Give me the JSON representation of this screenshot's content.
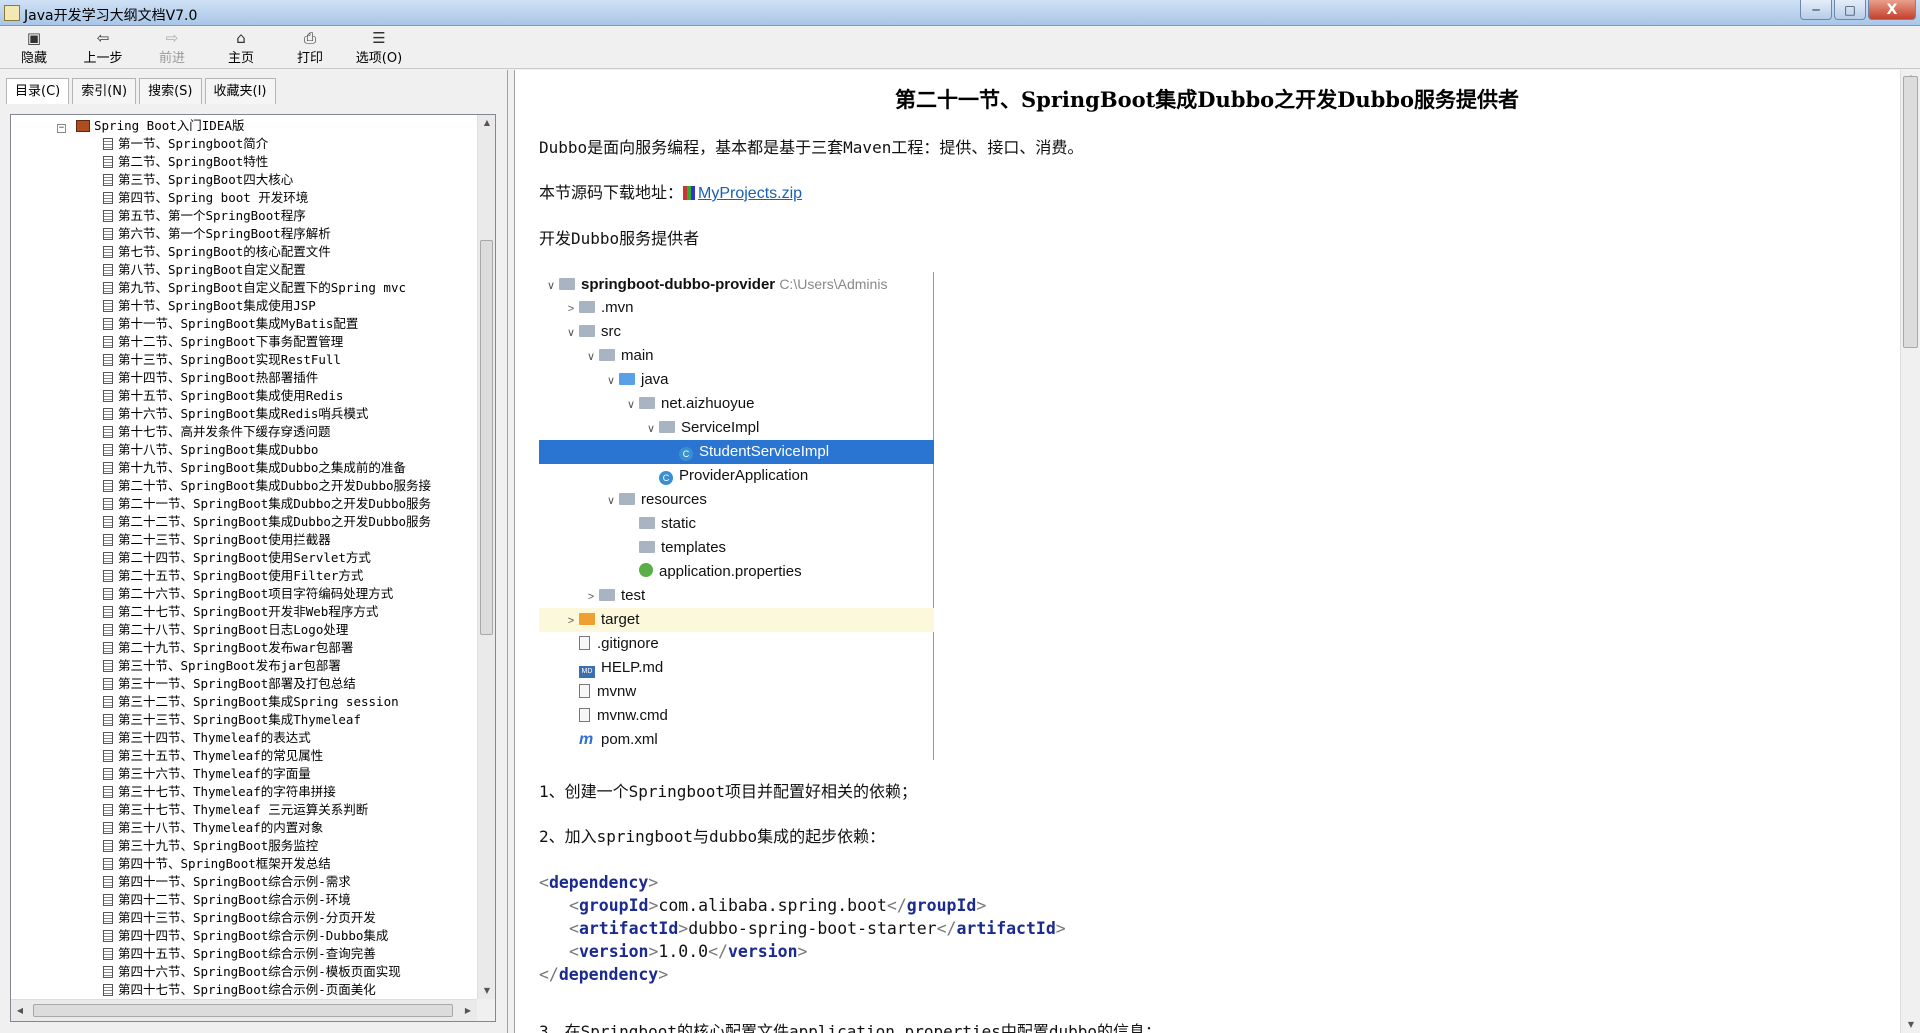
{
  "window": {
    "title": "Java开发学习大纲文档V7.0",
    "min": "─",
    "max": "□",
    "close": "X"
  },
  "toolbar": [
    {
      "label": "隐藏",
      "icon": "hide-icon",
      "glyph": "▣"
    },
    {
      "label": "上一步",
      "icon": "back-arrow-icon",
      "glyph": "⇦"
    },
    {
      "label": "前进",
      "icon": "forward-arrow-icon",
      "glyph": "⇨"
    },
    {
      "label": "主页",
      "icon": "home-icon",
      "glyph": "⌂"
    },
    {
      "label": "打印",
      "icon": "printer-icon",
      "glyph": "⎙"
    },
    {
      "label": "选项(O)",
      "icon": "options-icon",
      "glyph": "☰"
    }
  ],
  "tabs": [
    "目录(C)",
    "索引(N)",
    "搜索(S)",
    "收藏夹(I)"
  ],
  "tree": {
    "root": "Spring Boot入门IDEA版",
    "items": [
      "第一节、Springboot简介",
      "第二节、SpringBoot特性",
      "第三节、SpringBoot四大核心",
      "第四节、Spring boot 开发环境",
      "第五节、第一个SpringBoot程序",
      "第六节、第一个SpringBoot程序解析",
      "第七节、SpringBoot的核心配置文件",
      "第八节、SpringBoot自定义配置",
      "第九节、SpringBoot自定义配置下的Spring mvc",
      "第十节、SpringBoot集成使用JSP",
      "第十一节、SpringBoot集成MyBatis配置",
      "第十二节、SpringBoot下事务配置管理",
      "第十三节、SpringBoot实现RestFull",
      "第十四节、SpringBoot热部署插件",
      "第十五节、SpringBoot集成使用Redis",
      "第十六节、SpringBoot集成Redis哨兵模式",
      "第十七节、高并发条件下缓存穿透问题",
      "第十八节、SpringBoot集成Dubbo",
      "第十九节、SpringBoot集成Dubbo之集成前的准备",
      "第二十节、SpringBoot集成Dubbo之开发Dubbo服务接",
      "第二十一节、SpringBoot集成Dubbo之开发Dubbo服务",
      "第二十二节、SpringBoot集成Dubbo之开发Dubbo服务",
      "第二十三节、SpringBoot使用拦截器",
      "第二十四节、SpringBoot使用Servlet方式",
      "第二十五节、SpringBoot使用Filter方式",
      "第二十六节、SpringBoot项目字符编码处理方式",
      "第二十七节、SpringBoot开发非Web程序方式",
      "第二十八节、SpringBoot日志Logo处理",
      "第二十九节、SpringBoot发布war包部署",
      "第三十节、SpringBoot发布jar包部署",
      "第三十一节、SpringBoot部署及打包总结",
      "第三十二节、SpringBoot集成Spring session",
      "第三十三节、SpringBoot集成Thymeleaf",
      "第三十四节、Thymeleaf的表达式",
      "第三十五节、Thymeleaf的常见属性",
      "第三十六节、Thymeleaf的字面量",
      "第三十七节、Thymeleaf的字符串拼接",
      "第三十七节、Thymeleaf 三元运算关系判断",
      "第三十八节、Thymeleaf的内置对象",
      "第三十九节、SpringBoot服务监控",
      "第四十节、SpringBoot框架开发总结",
      "第四十一节、SpringBoot综合示例-需求",
      "第四十二节、SpringBoot综合示例-环境",
      "第四十三节、SpringBoot综合示例-分页开发",
      "第四十四节、SpringBoot综合示例-Dubbo集成",
      "第四十五节、SpringBoot综合示例-查询完善",
      "第四十六节、SpringBoot综合示例-模板页面实现",
      "第四十七节、SpringBoot综合示例-页面美化"
    ]
  },
  "content": {
    "title": "第二十一节、SpringBoot集成Dubbo之开发Dubbo服务提供者",
    "p1": "Dubbo是面向服务编程，基本都是基于三套Maven工程：提供、接口、消费。",
    "p2_prefix": "本节源码下载地址：",
    "p2_link": "MyProjects.zip",
    "p3": "开发Dubbo服务提供者",
    "step1": "1、创建一个Springboot项目并配置好相关的依赖；",
    "step2": "2、加入springboot与dubbo集成的起步依赖：",
    "step3": "3、在Springboot的核心配置文件application.properties中配置dubbo的信息：",
    "code": {
      "dependency": "dependency",
      "groupId_tag": "groupId",
      "groupId": "com.alibaba.spring.boot",
      "artifactId_tag": "artifactId",
      "artifactId": "dubbo-spring-boot-starter",
      "version_tag": "version",
      "version": "1.0.0"
    }
  },
  "project_tree": [
    {
      "label": "springboot-dubbo-provider",
      "path": "C:\\Users\\Adminis",
      "level": 0,
      "chev": "∨",
      "icon": "module",
      "bold": true
    },
    {
      "label": ".mvn",
      "level": 1,
      "chev": ">",
      "icon": "folder"
    },
    {
      "label": "src",
      "level": 1,
      "chev": "∨",
      "icon": "folder"
    },
    {
      "label": "main",
      "level": 2,
      "chev": "∨",
      "icon": "folder"
    },
    {
      "label": "java",
      "level": 3,
      "chev": "∨",
      "icon": "folder-blue"
    },
    {
      "label": "net.aizhuoyue",
      "level": 4,
      "chev": "∨",
      "icon": "folder"
    },
    {
      "label": "ServiceImpl",
      "level": 5,
      "chev": "∨",
      "icon": "folder"
    },
    {
      "label": "StudentServiceImpl",
      "level": 6,
      "chev": "",
      "icon": "class",
      "selected": true
    },
    {
      "label": "ProviderApplication",
      "level": 5,
      "chev": "",
      "icon": "class"
    },
    {
      "label": "resources",
      "level": 3,
      "chev": "∨",
      "icon": "folder"
    },
    {
      "label": "static",
      "level": 4,
      "chev": "",
      "icon": "folder"
    },
    {
      "label": "templates",
      "level": 4,
      "chev": "",
      "icon": "folder"
    },
    {
      "label": "application.properties",
      "level": 4,
      "chev": "",
      "icon": "properties"
    },
    {
      "label": "test",
      "level": 2,
      "chev": ">",
      "icon": "folder"
    },
    {
      "label": "target",
      "level": 1,
      "chev": ">",
      "icon": "folder-orange",
      "highlight": true
    },
    {
      "label": ".gitignore",
      "level": 1,
      "chev": "",
      "icon": "file"
    },
    {
      "label": "HELP.md",
      "level": 1,
      "chev": "",
      "icon": "md"
    },
    {
      "label": "mvnw",
      "level": 1,
      "chev": "",
      "icon": "file"
    },
    {
      "label": "mvnw.cmd",
      "level": 1,
      "chev": "",
      "icon": "file"
    },
    {
      "label": "pom.xml",
      "level": 1,
      "chev": "",
      "icon": "maven"
    }
  ],
  "colors": {
    "selection": "#2a75d1",
    "link": "#1a5fb4",
    "xml_tag": "#1b2a8f"
  }
}
